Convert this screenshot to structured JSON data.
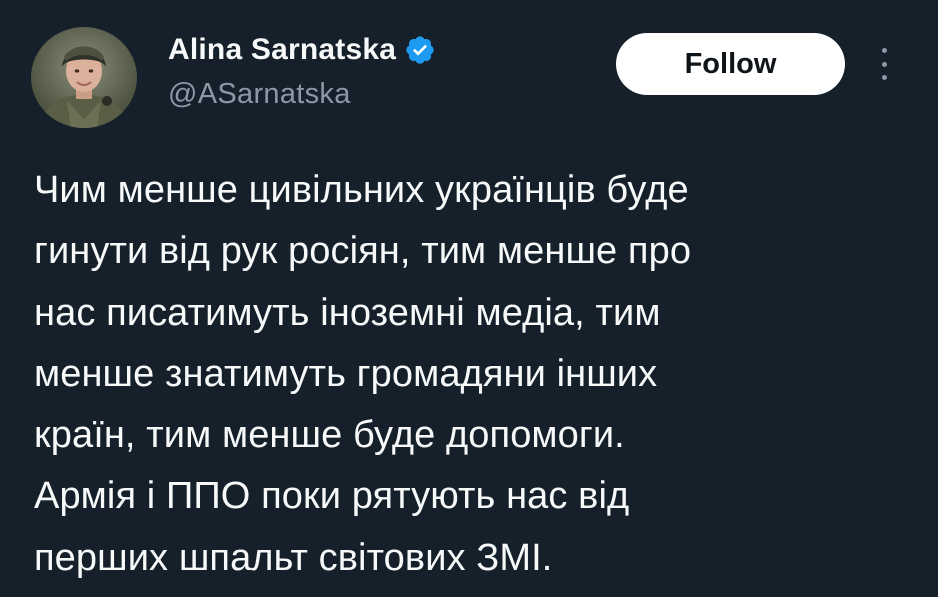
{
  "author": {
    "display_name": "Alina Sarnatska",
    "handle": "@ASarnatska",
    "verified": true,
    "verified_color": "#1d9bf0"
  },
  "actions": {
    "follow_label": "Follow",
    "more_icon": "more-vertical-icon"
  },
  "tweet": {
    "lines": [
      "Чим менше цивільних українців буде",
      "гинути від рук росіян, тим менше про",
      "нас писатимуть іноземні медіа, тим",
      "менше знатимуть громадяни інших",
      "країн, тим менше буде допомоги.",
      "Армія і ППО поки рятують нас від",
      "перших шпальт світових ЗМІ."
    ]
  },
  "theme": {
    "background": "#15202b",
    "text": "#f7f9f9",
    "secondary_text": "#8b98a5"
  }
}
